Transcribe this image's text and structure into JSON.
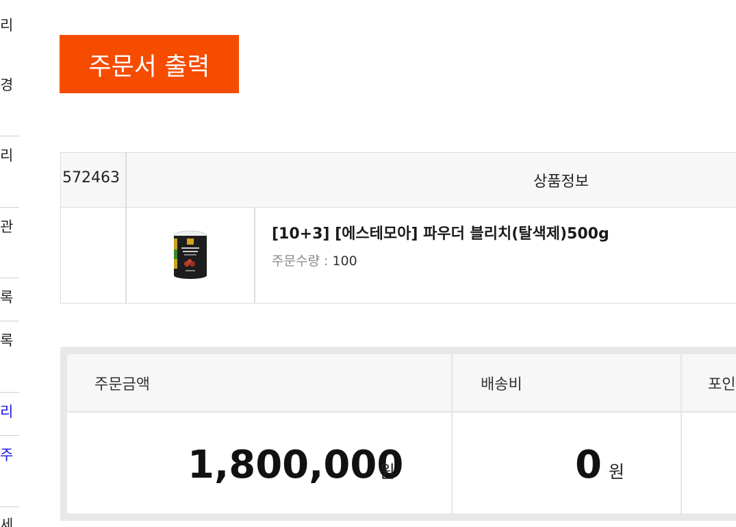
{
  "sidebar": {
    "items": [
      {
        "label": "리"
      },
      {
        "label": "경"
      },
      {
        "label": "리"
      },
      {
        "label": "관"
      },
      {
        "label": "록"
      },
      {
        "label": "록"
      },
      {
        "label": "리"
      },
      {
        "label": "주"
      },
      {
        "label": "세"
      }
    ]
  },
  "actions": {
    "print_label": "주문서 출력"
  },
  "order": {
    "order_no": "572463",
    "header_title": "상품정보",
    "product": {
      "name": "[10+3] [에스테모아] 파우더 블리치(탈색제)500g",
      "qty_label": "주문수량 : ",
      "qty_value": "100"
    }
  },
  "summary": {
    "order_amount_label": "주문금액",
    "shipping_label": "배송비",
    "points_label": "포인",
    "order_amount": "1,800,000",
    "shipping": "0",
    "currency": "원"
  },
  "colors": {
    "accent": "#f54c00",
    "link": "#1515e6"
  }
}
